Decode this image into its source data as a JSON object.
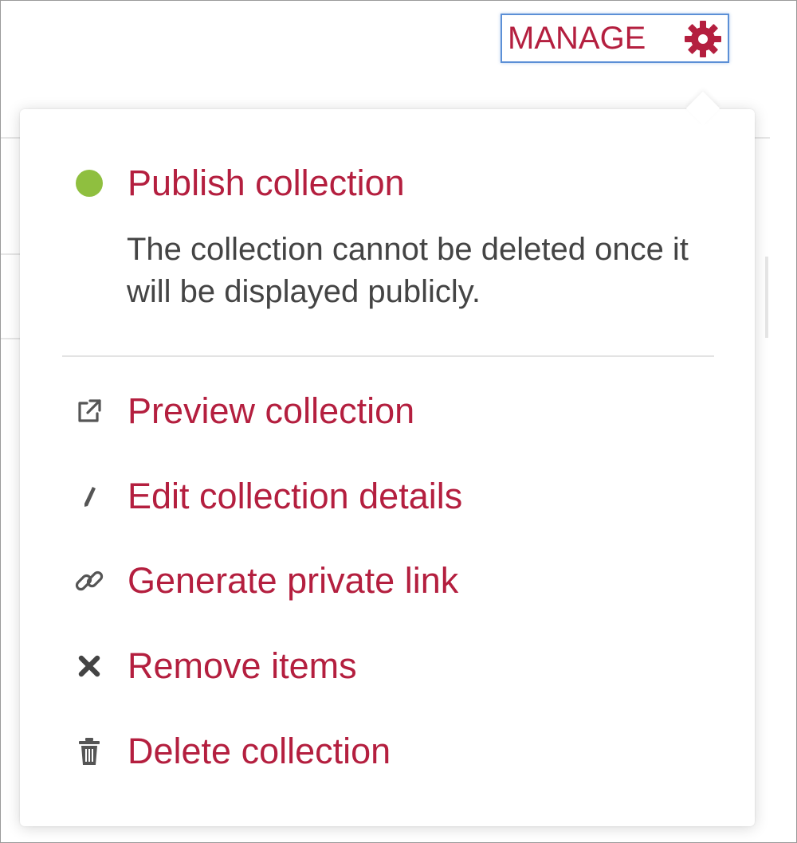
{
  "manage_button": {
    "label": "MANAGE",
    "icon": "gear-icon",
    "color": "#b41f3f",
    "focus_ring_color": "#5b8fd6"
  },
  "menu": {
    "publish": {
      "label": "Publish collection",
      "status_color": "#8fbf3f",
      "description": "The collection cannot be deleted once it will be displayed publicly."
    },
    "items": [
      {
        "label": "Preview collection",
        "icon": "external-link-icon"
      },
      {
        "label": "Edit collection details",
        "icon": "pencil-icon"
      },
      {
        "label": "Generate private link",
        "icon": "link-icon"
      },
      {
        "label": "Remove items",
        "icon": "close-icon"
      },
      {
        "label": "Delete collection",
        "icon": "trash-icon"
      }
    ],
    "item_color": "#b41f3f",
    "icon_color": "#555555"
  }
}
